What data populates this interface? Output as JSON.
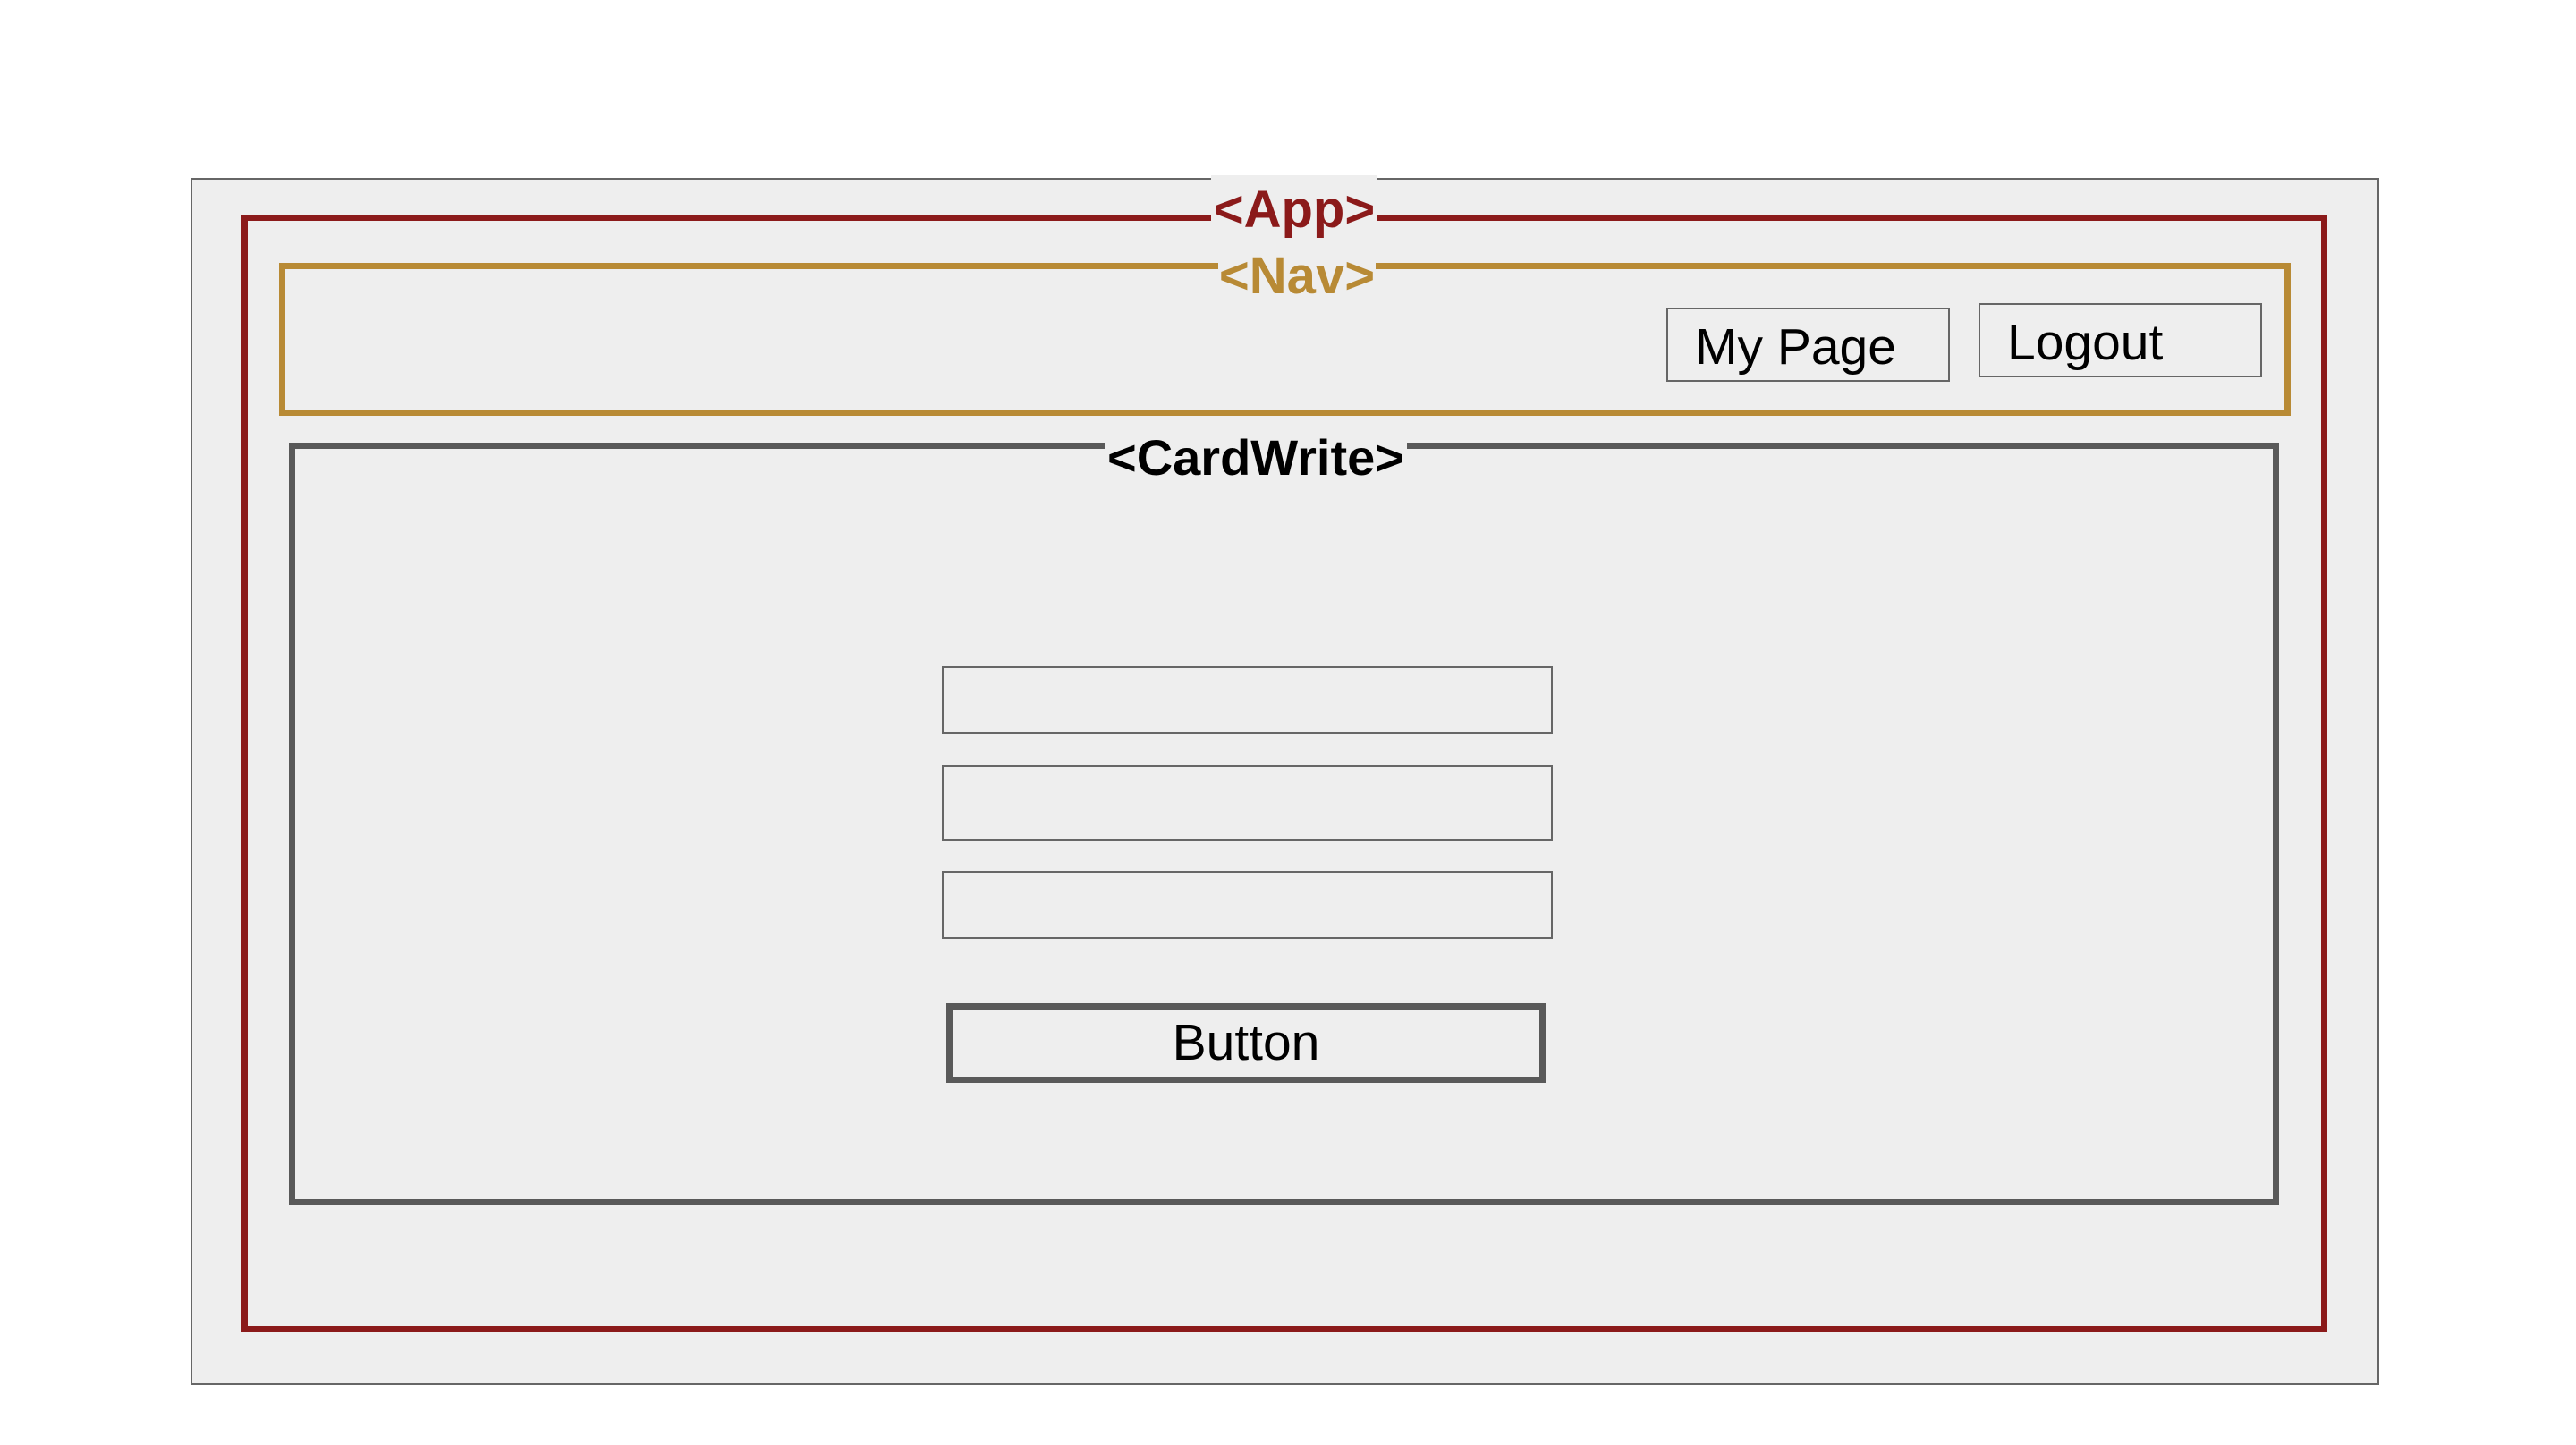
{
  "diagram": {
    "app": {
      "label": "<App>",
      "color": "#8b1a1a"
    },
    "nav": {
      "label": "<Nav>",
      "color": "#b88a35",
      "buttons": {
        "my_page": "My Page",
        "logout": "Logout"
      }
    },
    "card_write": {
      "label": "<CardWrite>",
      "color": "#595959",
      "input_count": 3,
      "button_label": "Button"
    },
    "frame_background": "#eeeeee"
  }
}
